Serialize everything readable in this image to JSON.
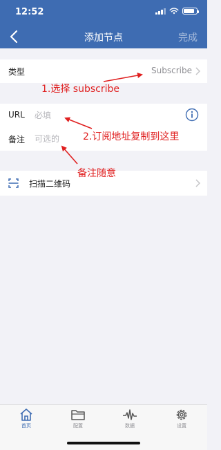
{
  "status_bar": {
    "time": "12:52"
  },
  "nav": {
    "title": "添加节点",
    "done_label": "完成"
  },
  "type_row": {
    "label": "类型",
    "value": "Subscribe"
  },
  "url_row": {
    "label": "URL",
    "placeholder": "必填",
    "value": ""
  },
  "remark_row": {
    "label": "备注",
    "placeholder": "可选的",
    "value": ""
  },
  "scan_row": {
    "label": "扫描二维码"
  },
  "annotations": {
    "step1": "1.选择 subscribe",
    "step2": "2.订阅地址复制到这里",
    "step3": "备注随意"
  },
  "tabs": [
    {
      "label": "首页",
      "icon": "home-icon",
      "active": true
    },
    {
      "label": "配置",
      "icon": "folder-icon",
      "active": false
    },
    {
      "label": "数据",
      "icon": "waveform-icon",
      "active": false
    },
    {
      "label": "设置",
      "icon": "gear-icon",
      "active": false
    }
  ],
  "colors": {
    "nav_bar": "#3e6cb2",
    "annotation": "#e02020",
    "active_tab": "#3e6cb2",
    "background": "#f2f2f7"
  }
}
